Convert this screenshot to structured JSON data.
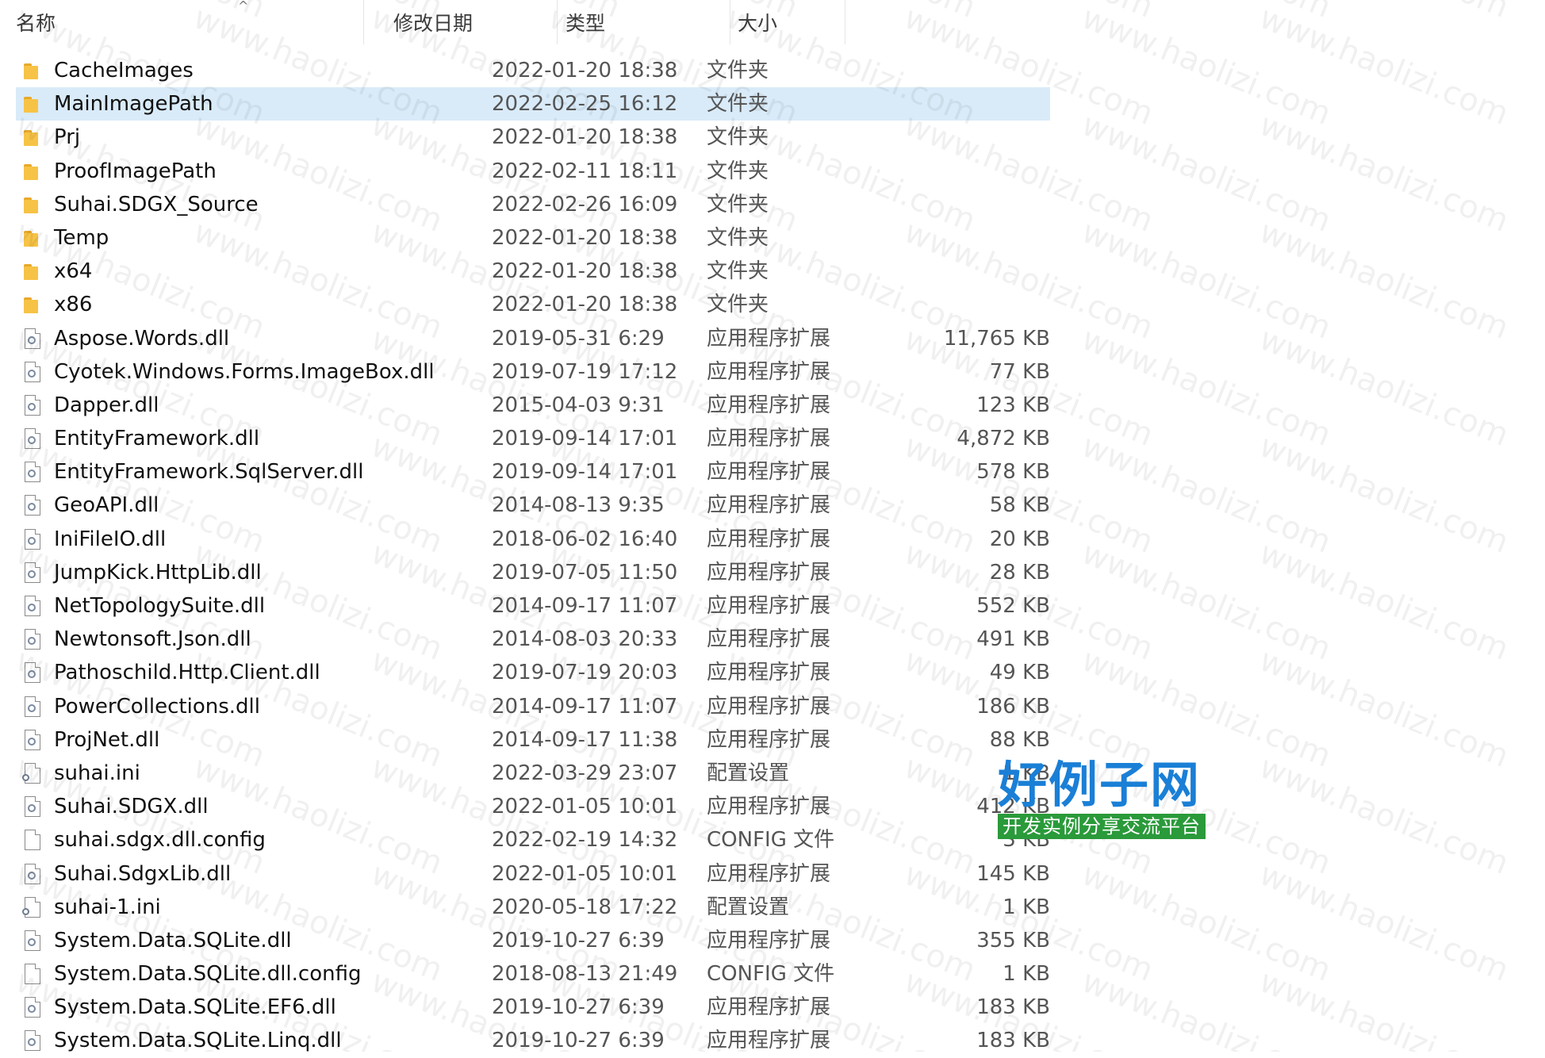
{
  "header": {
    "name_label": "名称",
    "date_label": "修改日期",
    "type_label": "类型",
    "size_label": "大小",
    "sort_indicator": "^"
  },
  "files": [
    {
      "icon": "folder-icon",
      "name": "CacheImages",
      "date": "2022-01-20 18:38",
      "type": "文件夹",
      "size": ""
    },
    {
      "icon": "folder-icon",
      "name": "MainImagePath",
      "date": "2022-02-25 16:12",
      "type": "文件夹",
      "size": "",
      "selected": true
    },
    {
      "icon": "folder-icon",
      "name": "Prj",
      "date": "2022-01-20 18:38",
      "type": "文件夹",
      "size": ""
    },
    {
      "icon": "folder-icon",
      "name": "ProofImagePath",
      "date": "2022-02-11 18:11",
      "type": "文件夹",
      "size": ""
    },
    {
      "icon": "folder-icon",
      "name": "Suhai.SDGX_Source",
      "date": "2022-02-26 16:09",
      "type": "文件夹",
      "size": ""
    },
    {
      "icon": "folder-icon",
      "name": "Temp",
      "date": "2022-01-20 18:38",
      "type": "文件夹",
      "size": ""
    },
    {
      "icon": "folder-icon",
      "name": "x64",
      "date": "2022-01-20 18:38",
      "type": "文件夹",
      "size": ""
    },
    {
      "icon": "folder-icon",
      "name": "x86",
      "date": "2022-01-20 18:38",
      "type": "文件夹",
      "size": ""
    },
    {
      "icon": "dll-icon",
      "name": "Aspose.Words.dll",
      "date": "2019-05-31 6:29",
      "type": "应用程序扩展",
      "size": "11,765 KB"
    },
    {
      "icon": "dll-icon",
      "name": "Cyotek.Windows.Forms.ImageBox.dll",
      "date": "2019-07-19 17:12",
      "type": "应用程序扩展",
      "size": "77 KB"
    },
    {
      "icon": "dll-icon",
      "name": "Dapper.dll",
      "date": "2015-04-03 9:31",
      "type": "应用程序扩展",
      "size": "123 KB"
    },
    {
      "icon": "dll-icon",
      "name": "EntityFramework.dll",
      "date": "2019-09-14 17:01",
      "type": "应用程序扩展",
      "size": "4,872 KB"
    },
    {
      "icon": "dll-icon",
      "name": "EntityFramework.SqlServer.dll",
      "date": "2019-09-14 17:01",
      "type": "应用程序扩展",
      "size": "578 KB"
    },
    {
      "icon": "dll-icon",
      "name": "GeoAPI.dll",
      "date": "2014-08-13 9:35",
      "type": "应用程序扩展",
      "size": "58 KB"
    },
    {
      "icon": "dll-icon",
      "name": "IniFileIO.dll",
      "date": "2018-06-02 16:40",
      "type": "应用程序扩展",
      "size": "20 KB"
    },
    {
      "icon": "dll-icon",
      "name": "JumpKick.HttpLib.dll",
      "date": "2019-07-05 11:50",
      "type": "应用程序扩展",
      "size": "28 KB"
    },
    {
      "icon": "dll-icon",
      "name": "NetTopologySuite.dll",
      "date": "2014-09-17 11:07",
      "type": "应用程序扩展",
      "size": "552 KB"
    },
    {
      "icon": "dll-icon",
      "name": "Newtonsoft.Json.dll",
      "date": "2014-08-03 20:33",
      "type": "应用程序扩展",
      "size": "491 KB"
    },
    {
      "icon": "dll-icon",
      "name": "Pathoschild.Http.Client.dll",
      "date": "2019-07-19 20:03",
      "type": "应用程序扩展",
      "size": "49 KB"
    },
    {
      "icon": "dll-icon",
      "name": "PowerCollections.dll",
      "date": "2014-09-17 11:07",
      "type": "应用程序扩展",
      "size": "186 KB"
    },
    {
      "icon": "dll-icon",
      "name": "ProjNet.dll",
      "date": "2014-09-17 11:38",
      "type": "应用程序扩展",
      "size": "88 KB"
    },
    {
      "icon": "ini-icon",
      "name": "suhai.ini",
      "date": "2022-03-29 23:07",
      "type": "配置设置",
      "size": "1 KB"
    },
    {
      "icon": "dll-icon",
      "name": "Suhai.SDGX.dll",
      "date": "2022-01-05 10:01",
      "type": "应用程序扩展",
      "size": "412 KB"
    },
    {
      "icon": "config-icon",
      "name": "suhai.sdgx.dll.config",
      "date": "2022-02-19 14:32",
      "type": "CONFIG 文件",
      "size": "3 KB"
    },
    {
      "icon": "dll-icon",
      "name": "Suhai.SdgxLib.dll",
      "date": "2022-01-05 10:01",
      "type": "应用程序扩展",
      "size": "145 KB"
    },
    {
      "icon": "ini-icon",
      "name": "suhai-1.ini",
      "date": "2020-05-18 17:22",
      "type": "配置设置",
      "size": "1 KB"
    },
    {
      "icon": "dll-icon",
      "name": "System.Data.SQLite.dll",
      "date": "2019-10-27 6:39",
      "type": "应用程序扩展",
      "size": "355 KB"
    },
    {
      "icon": "config-icon",
      "name": "System.Data.SQLite.dll.config",
      "date": "2018-08-13 21:49",
      "type": "CONFIG 文件",
      "size": "1 KB"
    },
    {
      "icon": "dll-icon",
      "name": "System.Data.SQLite.EF6.dll",
      "date": "2019-10-27 6:39",
      "type": "应用程序扩展",
      "size": "183 KB"
    },
    {
      "icon": "dll-icon",
      "name": "System.Data.SQLite.Linq.dll",
      "date": "2019-10-27 6:39",
      "type": "应用程序扩展",
      "size": "183 KB"
    }
  ],
  "watermark": {
    "text": "www.haolizi.com"
  },
  "logo": {
    "main_text": "好例子网",
    "sub_text": "开发实例分享交流平台"
  },
  "colors": {
    "selection": "#d9ebf9",
    "folder": "#f7c346",
    "logo_blue": "#1a7fd6",
    "logo_green": "#2a9a3a"
  }
}
